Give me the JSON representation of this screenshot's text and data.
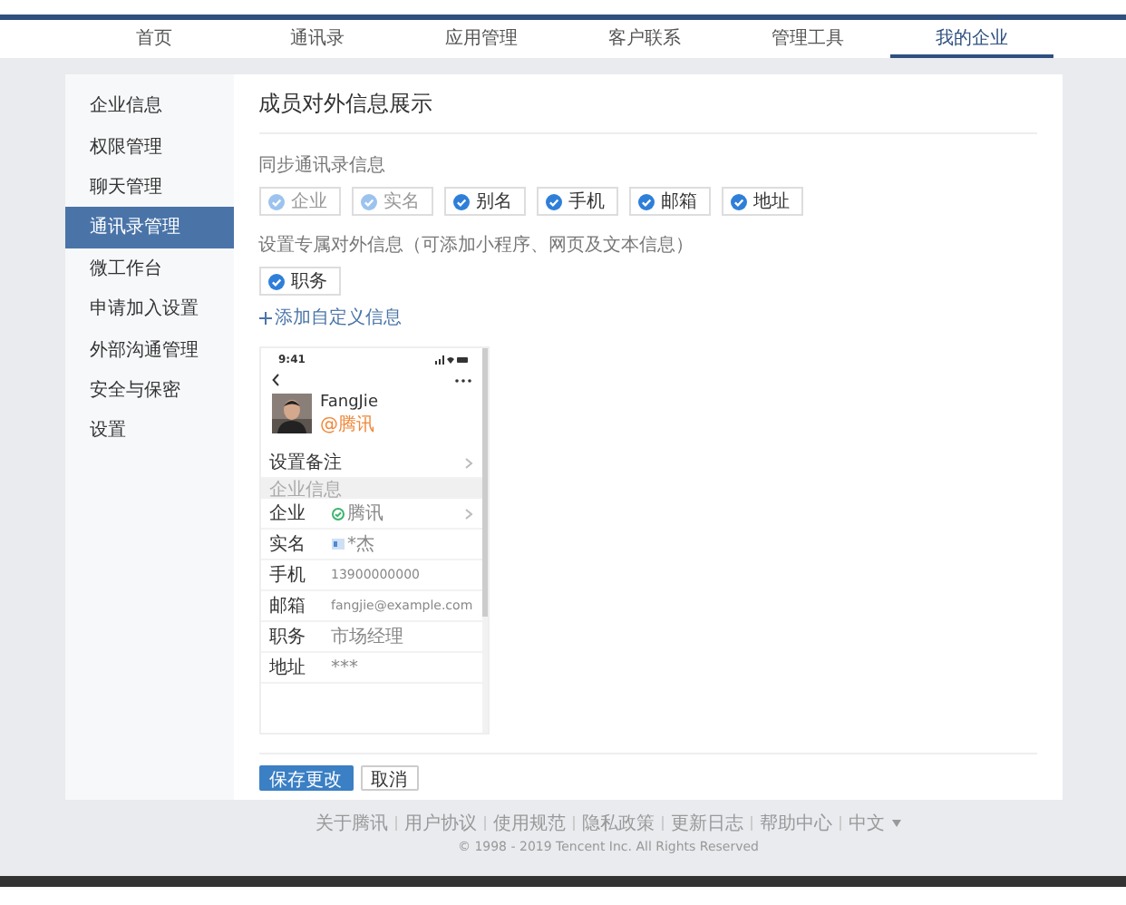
{
  "nav": [
    {
      "label": "首页",
      "selected": false
    },
    {
      "label": "通讯录",
      "selected": false
    },
    {
      "label": "应用管理",
      "selected": false
    },
    {
      "label": "客户联系",
      "selected": false
    },
    {
      "label": "管理工具",
      "selected": false
    },
    {
      "label": "我的企业",
      "selected": true
    }
  ],
  "sidebar": [
    {
      "label": "企业信息",
      "selected": false
    },
    {
      "label": "权限管理",
      "selected": false
    },
    {
      "label": "聊天管理",
      "selected": false
    },
    {
      "label": "通讯录管理",
      "selected": true
    },
    {
      "label": "微工作台",
      "selected": false
    },
    {
      "label": "申请加入设置",
      "selected": false
    },
    {
      "label": "外部沟通管理",
      "selected": false
    },
    {
      "label": "安全与保密",
      "selected": false
    },
    {
      "label": "设置",
      "selected": false
    }
  ],
  "page_title": "成员对外信息展示",
  "sync_section": {
    "label": "同步通讯录信息",
    "chips": [
      {
        "label": "企业",
        "checked": true,
        "disabled": true
      },
      {
        "label": "实名",
        "checked": true,
        "disabled": true
      },
      {
        "label": "别名",
        "checked": true,
        "disabled": false
      },
      {
        "label": "手机",
        "checked": true,
        "disabled": false
      },
      {
        "label": "邮箱",
        "checked": true,
        "disabled": false
      },
      {
        "label": "地址",
        "checked": true,
        "disabled": false
      }
    ]
  },
  "custom_section": {
    "label": "设置专属对外信息（可添加小程序、网页及文本信息）",
    "chips": [
      {
        "label": "职务",
        "checked": true,
        "disabled": false
      }
    ],
    "add_link": "添加自定义信息"
  },
  "preview": {
    "status_time": "9:41",
    "name": "FangJie",
    "company": "@腾讯",
    "remark": "设置备注",
    "section_header": "企业信息",
    "rows": [
      {
        "label": "企业",
        "value": "腾讯",
        "kind": "verified",
        "chevron": true
      },
      {
        "label": "实名",
        "value": "*杰",
        "kind": "masked",
        "chevron": false
      },
      {
        "label": "手机",
        "value": "13900000000",
        "kind": "plain",
        "chevron": false
      },
      {
        "label": "邮箱",
        "value": "fangjie@example.com",
        "kind": "plain",
        "chevron": false
      },
      {
        "label": "职务",
        "value": "市场经理",
        "kind": "plain",
        "chevron": false
      },
      {
        "label": "地址",
        "value": "***",
        "kind": "plain",
        "chevron": false
      }
    ]
  },
  "buttons": [
    {
      "label": "保存更改",
      "kind": "primary"
    },
    {
      "label": "取消",
      "kind": "secondary"
    }
  ],
  "footer": {
    "links": [
      "关于腾讯",
      "用户协议",
      "使用规范",
      "隐私政策",
      "更新日志",
      "帮助中心"
    ],
    "language": "中文",
    "copyright": "© 1998 - 2019 Tencent Inc. All Rights Reserved"
  }
}
